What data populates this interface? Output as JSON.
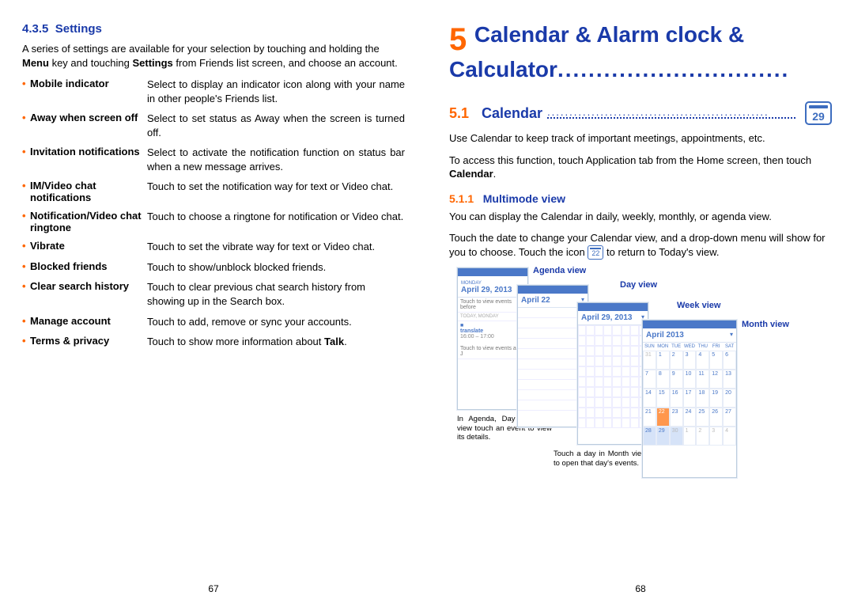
{
  "left": {
    "heading_num": "4.3.5",
    "heading_title": "Settings",
    "intro_a": "A series of settings are available for your selection by touching and holding the ",
    "intro_b": "Menu",
    "intro_c": " key and touching ",
    "intro_d": "Settings",
    "intro_e": " from Friends list screen, and choose an account.",
    "rows": [
      {
        "term": "Mobile indicator",
        "desc": "Select to display an indicator icon along with your name in other people's Friends list.",
        "justify": true
      },
      {
        "term": "Away when screen off",
        "desc": "Select to set status as Away when the screen is turned off.",
        "justify": true
      },
      {
        "term": "Invitation notifications",
        "desc": "Select to activate the notification function on status bar when a new message arrives.",
        "justify": true
      },
      {
        "term": "IM/Video chat notifications",
        "desc": "Touch to set the notification way for text or Video chat."
      },
      {
        "term": "Notification/Video chat ringtone",
        "desc": "Touch to choose a ringtone for notification or Video chat."
      },
      {
        "term": "Vibrate",
        "desc": "Touch to set the vibrate way for text or Video chat.",
        "justify": true
      },
      {
        "term": "Blocked friends",
        "desc": "Touch to show/unblock blocked friends."
      },
      {
        "term": "Clear search history",
        "desc": "Touch to clear previous chat search history from showing up in the Search box."
      },
      {
        "term": "Manage account",
        "desc": "Touch to add, remove or sync your accounts."
      },
      {
        "term": "Terms & privacy",
        "desc_a": "Touch to show more information about ",
        "desc_b": "Talk",
        "desc_c": "."
      }
    ],
    "page": "67"
  },
  "right": {
    "chapnum": "5",
    "chaptitle_a": "Calendar & Alarm clock & Calculator",
    "chaptitle_dots": "..............................",
    "h2num": "5.1",
    "h2title": "Calendar ",
    "cal_icon_num": "29",
    "p1": "Use Calendar to keep track of important meetings, appointments, etc.",
    "p2_a": "To access this function, touch Application tab from the Home screen, then touch ",
    "p2_b": "Calendar",
    "p2_c": ".",
    "h3num": "5.1.1",
    "h3title": "Multimode view",
    "p3": "You can display the Calendar in daily, weekly, monthly, or agenda view.",
    "p4_a": "Touch the date to change your Calendar view, and a drop-down menu will show for you to choose. Touch the icon ",
    "inline_icon_num": "22",
    "p4_b": " to return to Today's view.",
    "labels": {
      "agenda": "Agenda view",
      "day": "Day view",
      "week": "Week view",
      "month": "Month view"
    },
    "shot1": {
      "day": "MONDAY",
      "date": "April 29, 2013",
      "r1": "Touch to view events before",
      "evday": "TODAY, MONDAY",
      "ev1": "translate",
      "ev1t": "16:00 – 17:00",
      "r2": "Touch to view events after J"
    },
    "shot2": {
      "date": "April 22"
    },
    "shot3": {
      "date1": "April 29, 2013"
    },
    "shot4": {
      "date": "April 2013",
      "dow": [
        "SUN",
        "MON",
        "TUE",
        "WED",
        "THU",
        "FRI",
        "SAT"
      ],
      "days": [
        "31",
        "1",
        "2",
        "3",
        "4",
        "5",
        "6",
        "7",
        "8",
        "9",
        "10",
        "11",
        "12",
        "13",
        "14",
        "15",
        "16",
        "17",
        "18",
        "19",
        "20",
        "21",
        "22",
        "23",
        "24",
        "25",
        "26",
        "27",
        "28",
        "29",
        "30",
        "1",
        "2",
        "3",
        "4"
      ]
    },
    "cap1": "In Agenda, Day or Week view touch an event to view its details.",
    "cap2": "Touch a day in Month view to open that day's events.",
    "page": "68"
  }
}
